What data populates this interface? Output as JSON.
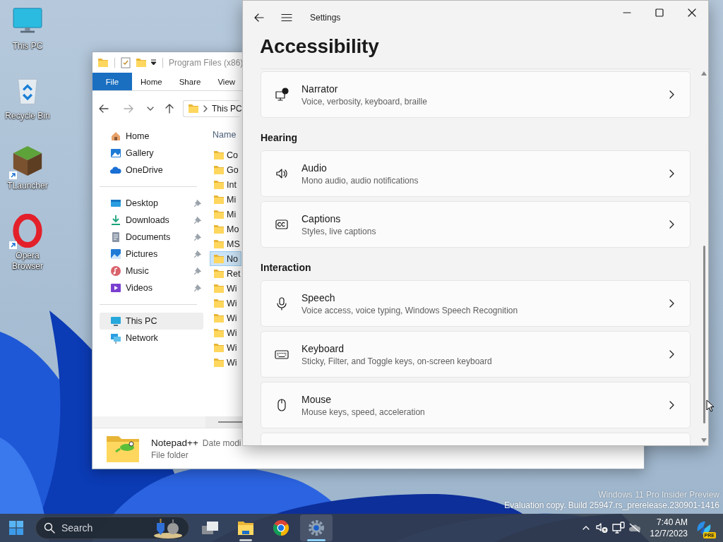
{
  "desktop_icons": [
    {
      "label": "This PC",
      "shortcut": false
    },
    {
      "label": "Recycle Bin",
      "shortcut": false
    },
    {
      "label": "TLauncher",
      "shortcut": true
    },
    {
      "label": "Opera Browser",
      "shortcut": true
    }
  ],
  "explorer": {
    "title": "Program Files (x86)",
    "ribbon_tabs": [
      {
        "label": "File",
        "selected": true
      },
      {
        "label": "Home",
        "selected": false
      },
      {
        "label": "Share",
        "selected": false
      },
      {
        "label": "View",
        "selected": false
      }
    ],
    "address": "This PC",
    "nav_sections": [
      {
        "items": [
          {
            "label": "Home",
            "pinned": false,
            "selected": false
          },
          {
            "label": "Gallery",
            "pinned": false,
            "selected": false
          },
          {
            "label": "OneDrive",
            "pinned": false,
            "selected": false
          }
        ]
      },
      {
        "items": [
          {
            "label": "Desktop",
            "pinned": true,
            "selected": false
          },
          {
            "label": "Downloads",
            "pinned": true,
            "selected": false
          },
          {
            "label": "Documents",
            "pinned": true,
            "selected": false
          },
          {
            "label": "Pictures",
            "pinned": true,
            "selected": false
          },
          {
            "label": "Music",
            "pinned": true,
            "selected": false
          },
          {
            "label": "Videos",
            "pinned": true,
            "selected": false
          }
        ]
      },
      {
        "items": [
          {
            "label": "This PC",
            "pinned": false,
            "selected": true
          },
          {
            "label": "Network",
            "pinned": false,
            "selected": false
          }
        ]
      }
    ],
    "files": {
      "column": "Name",
      "rows": [
        {
          "name": "Co",
          "selected": false
        },
        {
          "name": "Go",
          "selected": false
        },
        {
          "name": "Int",
          "selected": false
        },
        {
          "name": "Mi",
          "selected": false
        },
        {
          "name": "Mi",
          "selected": false
        },
        {
          "name": "Mo",
          "selected": false
        },
        {
          "name": "MS",
          "selected": false
        },
        {
          "name": "No",
          "selected": true
        },
        {
          "name": "Ret",
          "selected": false
        },
        {
          "name": "Wi",
          "selected": false
        },
        {
          "name": "Wi",
          "selected": false
        },
        {
          "name": "Wi",
          "selected": false
        },
        {
          "name": "Wi",
          "selected": false
        },
        {
          "name": "Wi",
          "selected": false
        },
        {
          "name": "Wi",
          "selected": false
        }
      ]
    },
    "details": {
      "name": "Notepad++",
      "date_label": "Date modi",
      "type": "File folder"
    }
  },
  "settings": {
    "title": "Settings",
    "heading": "Accessibility",
    "sections": [
      {
        "items": [
          {
            "title": "Narrator",
            "subtitle": "Voice, verbosity, keyboard, braille"
          }
        ]
      },
      {
        "heading": "Hearing",
        "items": [
          {
            "title": "Audio",
            "subtitle": "Mono audio, audio notifications"
          },
          {
            "title": "Captions",
            "subtitle": "Styles, live captions"
          }
        ]
      },
      {
        "heading": "Interaction",
        "items": [
          {
            "title": "Speech",
            "subtitle": "Voice access, voice typing, Windows Speech Recognition"
          },
          {
            "title": "Keyboard",
            "subtitle": "Sticky, Filter, and Toggle keys, on-screen keyboard"
          },
          {
            "title": "Mouse",
            "subtitle": "Mouse keys, speed, acceleration"
          }
        ]
      }
    ]
  },
  "desktop_notice": [
    "Windows 11 Pro Insider Preview",
    "Evaluation copy. Build 25947.rs_prerelease.230901-1416"
  ],
  "taskbar": {
    "search": {
      "placeholder": "Search"
    },
    "apps": [
      {
        "running": false,
        "active": false
      },
      {
        "running": true,
        "active": false
      },
      {
        "running": false,
        "active": false
      },
      {
        "running": true,
        "active": true
      }
    ],
    "clock": {
      "time": "7:40 AM",
      "date": "12/7/2023"
    },
    "badge": "PRE"
  }
}
